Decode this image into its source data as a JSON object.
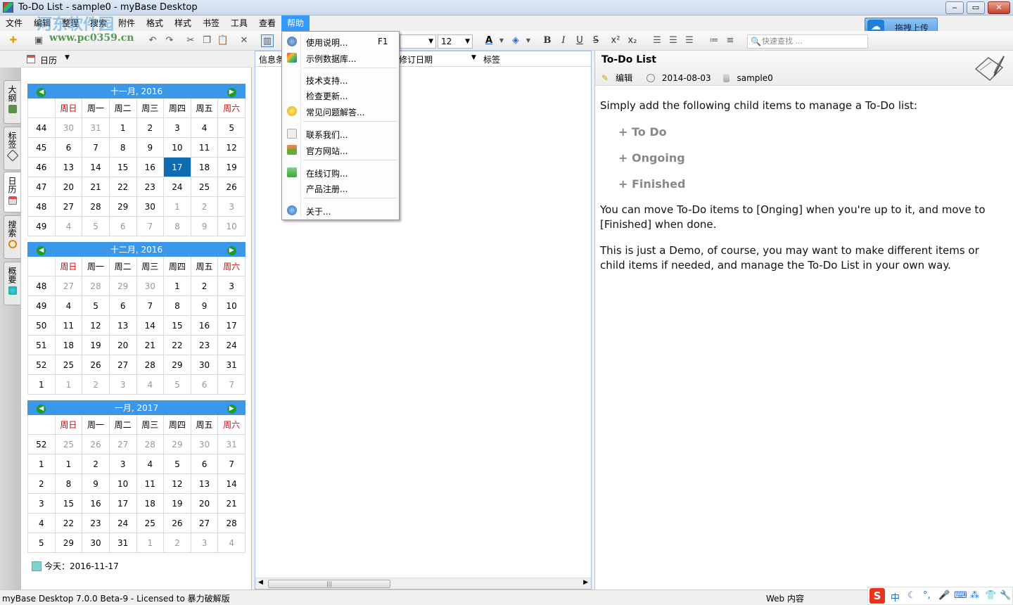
{
  "window": {
    "title": "To-Do List - sample0 - myBase Desktop",
    "min": "‒",
    "max": "▭",
    "close": "✕"
  },
  "menubar": {
    "items": [
      "文件",
      "编辑",
      "整理",
      "搜索",
      "附件",
      "格式",
      "样式",
      "书签",
      "工具",
      "查看",
      "帮助"
    ]
  },
  "upload": {
    "label": "拖拽上传"
  },
  "watermark": {
    "text": "www.pc0359.cn",
    "logo": "河东软件园"
  },
  "toolbar": {
    "font_size": "12",
    "search_placeholder": "快速查找 ..."
  },
  "help_menu": {
    "items": [
      {
        "label": "使用说明...",
        "shortcut": "F1",
        "icon": "help-icon"
      },
      {
        "label": "示例数据库...",
        "icon": "database-icon"
      },
      {
        "label": "技术支持...",
        "icon": ""
      },
      {
        "label": "检查更新...",
        "icon": ""
      },
      {
        "label": "常见问题解答...",
        "icon": "lightbulb-icon"
      },
      {
        "label": "联系我们...",
        "icon": "mail-icon"
      },
      {
        "label": "官方网站...",
        "icon": "home-icon"
      },
      {
        "label": "在线订购...",
        "icon": "cart-icon"
      },
      {
        "label": "产品注册...",
        "icon": ""
      },
      {
        "label": "关于...",
        "icon": "info-icon"
      }
    ]
  },
  "side_tabs": [
    "大纲",
    "标签",
    "日历",
    "搜索",
    "概要"
  ],
  "calendar": {
    "header": "日历",
    "days_of_week": [
      "周日",
      "周一",
      "周二",
      "周三",
      "周四",
      "周五",
      "周六"
    ],
    "months": [
      {
        "title": "十一月, 2016",
        "rows": [
          [
            "44",
            "30",
            "31",
            "1",
            "2",
            "3",
            "4",
            "5"
          ],
          [
            "45",
            "6",
            "7",
            "8",
            "9",
            "10",
            "11",
            "12"
          ],
          [
            "46",
            "13",
            "14",
            "15",
            "16",
            "17",
            "18",
            "19"
          ],
          [
            "47",
            "20",
            "21",
            "22",
            "23",
            "24",
            "25",
            "26"
          ],
          [
            "48",
            "27",
            "28",
            "29",
            "30",
            "1",
            "2",
            "3"
          ],
          [
            "49",
            "4",
            "5",
            "6",
            "7",
            "8",
            "9",
            "10"
          ]
        ]
      },
      {
        "title": "十二月, 2016",
        "rows": [
          [
            "48",
            "27",
            "28",
            "29",
            "30",
            "1",
            "2",
            "3"
          ],
          [
            "49",
            "4",
            "5",
            "6",
            "7",
            "8",
            "9",
            "10"
          ],
          [
            "50",
            "11",
            "12",
            "13",
            "14",
            "15",
            "16",
            "17"
          ],
          [
            "51",
            "18",
            "19",
            "20",
            "21",
            "22",
            "23",
            "24"
          ],
          [
            "52",
            "25",
            "26",
            "27",
            "28",
            "29",
            "30",
            "31"
          ],
          [
            "1",
            "1",
            "2",
            "3",
            "4",
            "5",
            "6",
            "7"
          ]
        ]
      },
      {
        "title": "一月, 2017",
        "rows": [
          [
            "52",
            "25",
            "26",
            "27",
            "28",
            "29",
            "30",
            "31"
          ],
          [
            "1",
            "1",
            "2",
            "3",
            "4",
            "5",
            "6",
            "7"
          ],
          [
            "2",
            "8",
            "9",
            "10",
            "11",
            "12",
            "13",
            "14"
          ],
          [
            "3",
            "15",
            "16",
            "17",
            "18",
            "19",
            "20",
            "21"
          ],
          [
            "4",
            "22",
            "23",
            "24",
            "25",
            "26",
            "27",
            "28"
          ],
          [
            "5",
            "29",
            "30",
            "31",
            "1",
            "2",
            "3",
            "4"
          ]
        ]
      }
    ],
    "today_label": "今天：2016-11-17"
  },
  "list": {
    "columns": [
      "信息条",
      "修订日期",
      "标签"
    ]
  },
  "note": {
    "title": "To-Do List",
    "edit_label": "编辑",
    "date": "2014-08-03",
    "database": "sample0",
    "intro": "Simply add the following child items to manage a To-Do list:",
    "items": [
      "+ To Do",
      "+ Ongoing",
      "+ Finished"
    ],
    "para1": "You can move To-Do items to [Onging] when you're up to it, and move to [Finished] when done.",
    "para2": "This is just a Demo, of course, you may want to make different items or child items if needed, and manage the To-Do List in your own way."
  },
  "status": {
    "left": "myBase Desktop 7.0.0 Beta-9 - Licensed to 暴力破解版",
    "right": "Web 内容"
  },
  "ime": {
    "logo": "S",
    "lang": "中"
  },
  "colors": {
    "accent": "#3399ff",
    "calendar_header": "#3b98e8",
    "today": "#0f6bb0",
    "weekend": "#dd0000"
  }
}
